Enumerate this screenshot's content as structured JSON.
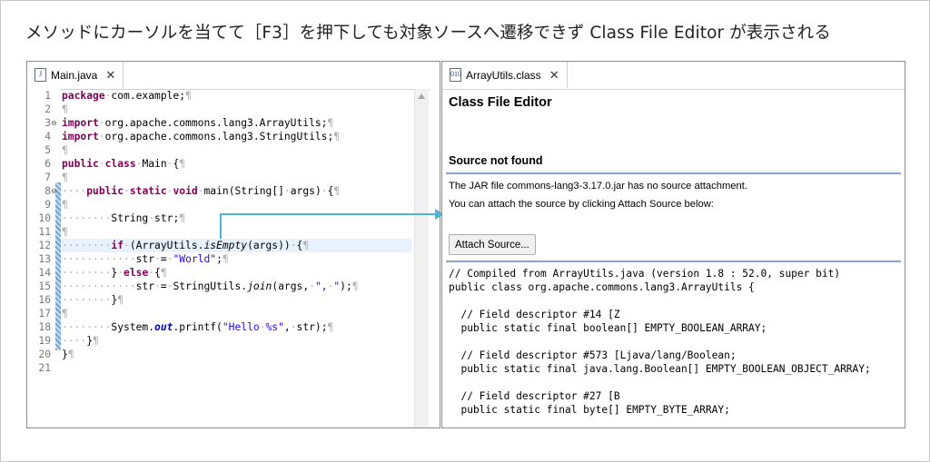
{
  "caption": "メソッドにカーソルを当てて［F3］を押下しても対象ソースへ遷移できず Class File Editor が表示される",
  "left_tab": {
    "label": "Main.java",
    "icon": "java-file-icon",
    "close": "✕"
  },
  "right_tab": {
    "label": "ArrayUtils.class",
    "icon": "class-file-icon",
    "close": "✕"
  },
  "code_lines": [
    {
      "n": "1"
    },
    {
      "n": "2"
    },
    {
      "n": "3"
    },
    {
      "n": "4"
    },
    {
      "n": "5"
    },
    {
      "n": "6"
    },
    {
      "n": "7"
    },
    {
      "n": "8"
    },
    {
      "n": "9"
    },
    {
      "n": "10"
    },
    {
      "n": "11"
    },
    {
      "n": "12"
    },
    {
      "n": "13"
    },
    {
      "n": "14"
    },
    {
      "n": "15"
    },
    {
      "n": "16"
    },
    {
      "n": "17"
    },
    {
      "n": "18"
    },
    {
      "n": "19"
    },
    {
      "n": "20"
    },
    {
      "n": "21"
    }
  ],
  "code": {
    "l1_kw": "package",
    "l1_rest": "com.example;",
    "l3_kw": "import",
    "l3_rest": "org.apache.commons.lang3.ArrayUtils;",
    "l4_kw": "import",
    "l4_rest": "org.apache.commons.lang3.StringUtils;",
    "l6_kw1": "public",
    "l6_kw2": "class",
    "l6_rest": "Main",
    "l6_brace": "{",
    "l8_kw1": "public",
    "l8_kw2": "static",
    "l8_kw3": "void",
    "l8_rest": "main(String[]",
    "l8_args": "args)",
    "l8_brace": "{",
    "l10_type": "String",
    "l10_var": "str;",
    "l12_kw": "if",
    "l12_a": "(ArrayUtils.",
    "l12_m": "isEmpty",
    "l12_b": "(args))",
    "l12_brace": "{",
    "l13_var": "str",
    "l13_eq": "=",
    "l13_str": "\"World\"",
    "l13_end": ";",
    "l14_a": "}",
    "l14_kw": "else",
    "l14_brace": "{",
    "l15_var": "str",
    "l15_eq": "=",
    "l15_a": "StringUtils.",
    "l15_m": "join",
    "l15_b": "(args,",
    "l15_str": "\",",
    "l15_str2": "\"",
    "l15_end": ");",
    "l16_brace": "}",
    "l18_a": "System.",
    "l18_f": "out",
    "l18_b": ".printf(",
    "l18_str": "\"Hello",
    "l18_str2": "%s\"",
    "l18_c": ",",
    "l18_d": "str);",
    "l19_brace": "}",
    "l20_brace": "}"
  },
  "class_editor": {
    "title": "Class File Editor",
    "source_not_found": "Source not found",
    "message1": "The JAR file commons-lang3-3.17.0.jar has no source attachment.",
    "message2": "You can attach the source by clicking Attach Source below:",
    "attach_button": "Attach Source...",
    "decompiled": [
      "// Compiled from ArrayUtils.java (version 1.8 : 52.0, super bit)",
      "public class org.apache.commons.lang3.ArrayUtils {",
      "",
      "  // Field descriptor #14 [Z",
      "  public static final boolean[] EMPTY_BOOLEAN_ARRAY;",
      "",
      "  // Field descriptor #573 [Ljava/lang/Boolean;",
      "  public static final java.lang.Boolean[] EMPTY_BOOLEAN_OBJECT_ARRAY;",
      "",
      "  // Field descriptor #27 [B",
      "  public static final byte[] EMPTY_BYTE_ARRAY;"
    ]
  },
  "colors": {
    "keyword": "#7f0055",
    "string": "#2a00ff",
    "arrow": "#4db6d0",
    "highlight": "#e8f2fe"
  }
}
